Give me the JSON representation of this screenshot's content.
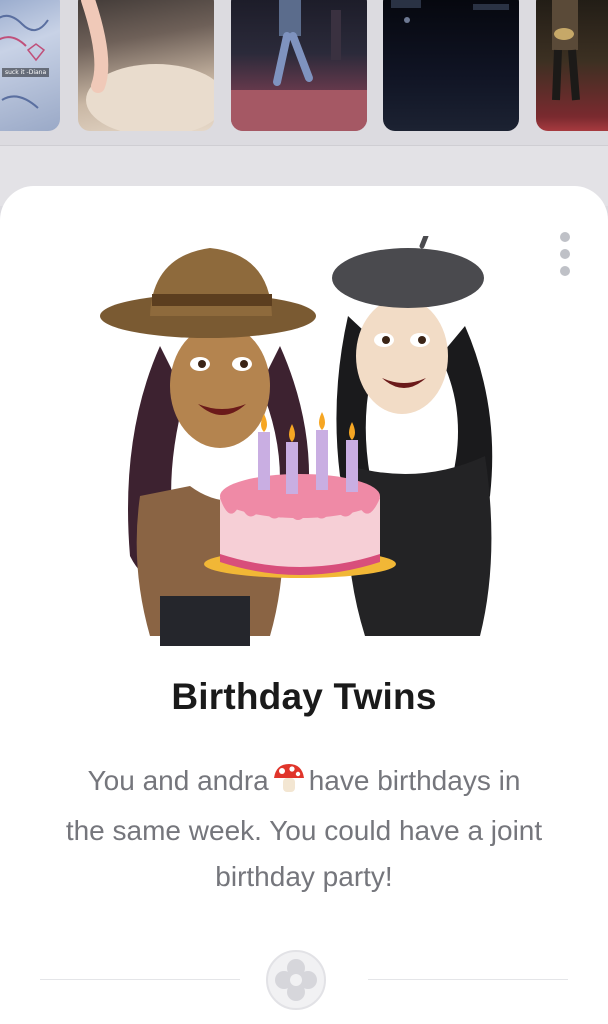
{
  "thumbnails": {
    "caption": "suck it -Diana",
    "items": [
      "thumbnail-notebook",
      "thumbnail-cat",
      "thumbnail-stage-performer",
      "thumbnail-dark-stage",
      "thumbnail-guitarist"
    ]
  },
  "card": {
    "title": "Birthday Twins",
    "body_line_1_start": "You and andra",
    "body_line_1_end": "have birthdays in",
    "body_line_2": "the same week. You could have a joint",
    "body_line_3": "birthday party!",
    "menu_icon": "more-vertical-icon",
    "emoji": "mushroom-emoji",
    "badge_icon": "friendship-charm-icon"
  },
  "colors": {
    "title": "#1a1a1a",
    "body": "#75767c",
    "card_bg": "#ffffff",
    "backdrop": "#dcdbe0"
  }
}
